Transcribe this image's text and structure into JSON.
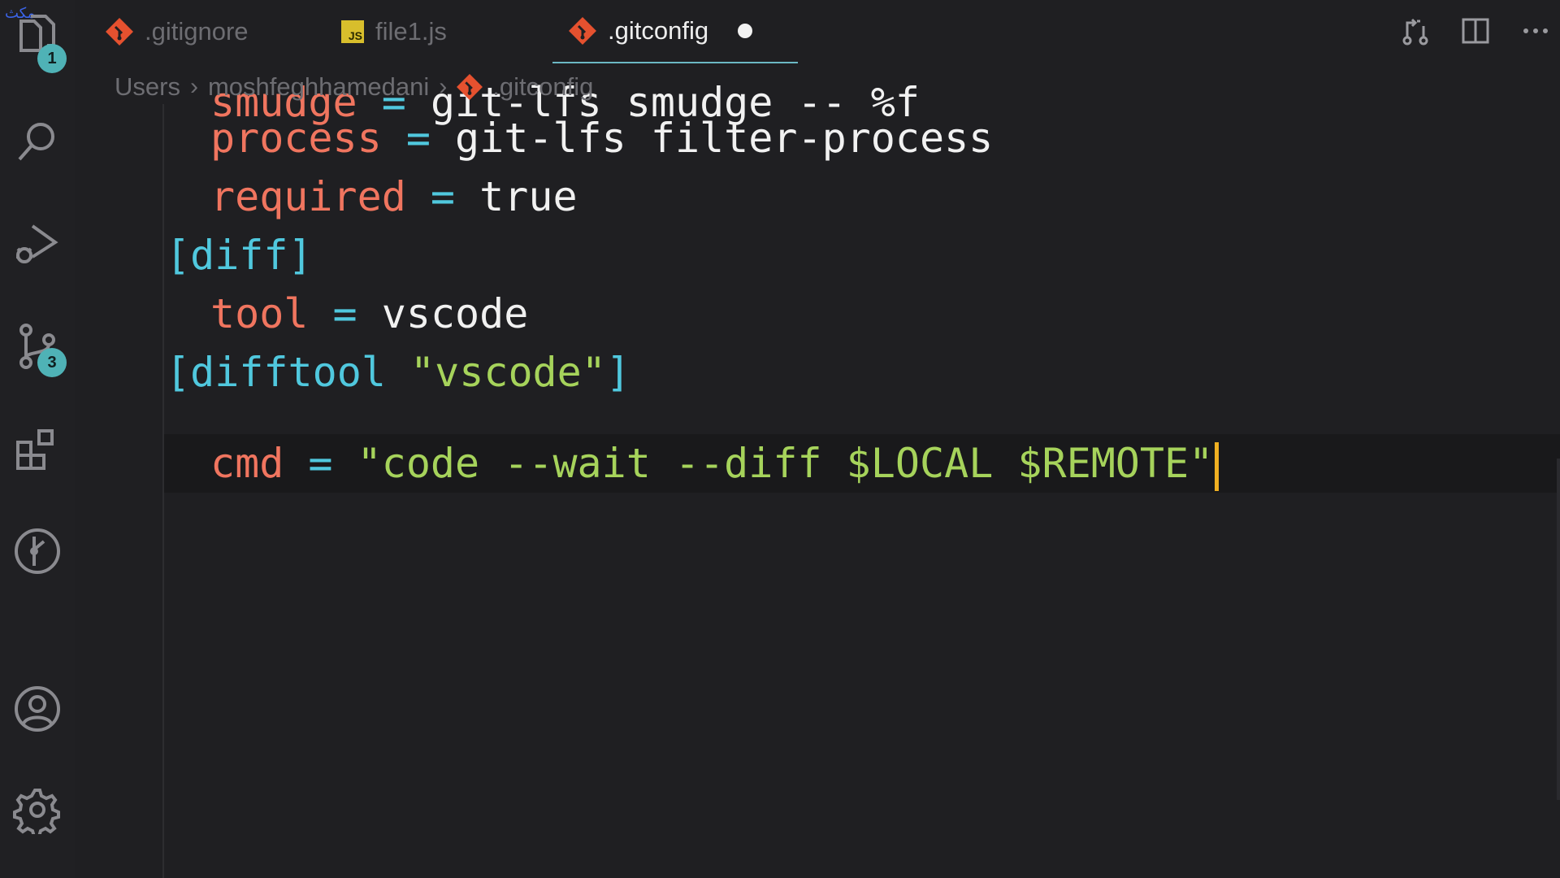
{
  "corner_text": "مکث",
  "activity_bar": {
    "explorer_badge": "1",
    "source_control_badge": "3",
    "items": [
      "files-icon",
      "search-icon",
      "run-debug-icon",
      "source-control-icon",
      "extensions-icon",
      "git-graph-icon",
      "account-icon",
      "settings-gear-icon"
    ]
  },
  "tabs": [
    {
      "label": ".gitignore",
      "icon": "git-icon",
      "active": false
    },
    {
      "label": "file1.js",
      "icon": "js-icon",
      "icon_text": "JS",
      "active": false
    },
    {
      "label": ".gitconfig",
      "icon": "git-icon",
      "active": true,
      "dirty": true
    }
  ],
  "breadcrumb": [
    "Users",
    "moshfeghhamedani",
    ".gitconfig"
  ],
  "code": {
    "line0": {
      "key": "smudge",
      "op": " = ",
      "val": "git-lfs smudge -- %f"
    },
    "line1": {
      "key": "process",
      "op": " = ",
      "val": "git-lfs filter-process"
    },
    "line2": {
      "key": "required",
      "op": " = ",
      "val": "true"
    },
    "line3": {
      "section": "[diff]"
    },
    "line4": {
      "key": "tool",
      "op": " = ",
      "val": "vscode"
    },
    "line5": {
      "section_open": "[difftool ",
      "section_str": "\"vscode\"",
      "section_close": "]"
    },
    "line6": {
      "key": "cmd",
      "op": " = ",
      "str": "\"code --wait --diff $LOCAL $REMOTE\""
    }
  },
  "colors": {
    "key": "#f0755f",
    "operator": "#50c8de",
    "string": "#a6d35b",
    "badge": "#4fb2b6",
    "cursor": "#f0b022",
    "git": "#e5512f"
  }
}
